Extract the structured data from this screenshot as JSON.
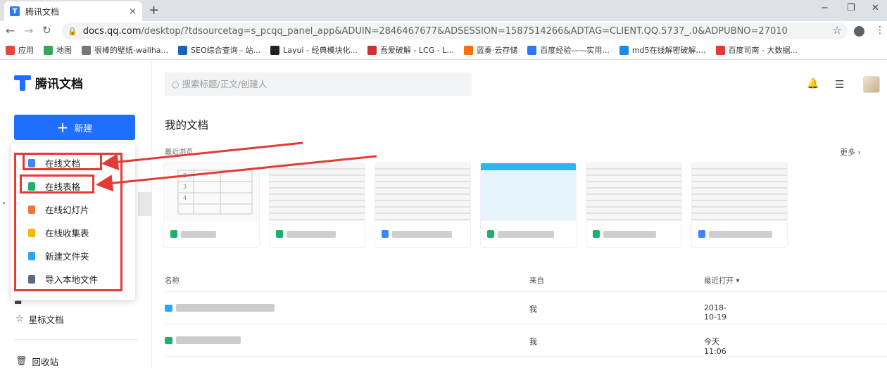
{
  "browser": {
    "tab_title": "腾讯文档",
    "tab_close": "×",
    "new_tab": "+",
    "url_host": "docs.qq.com",
    "url_rest": "/desktop/?tdsourcetag=s_pcqq_panel_app&ADUIN=2846467677&ADSESSION=1587514266&ADTAG=CLIENT.QQ.5737_.0&ADPUBNO=27010",
    "window_controls": [
      "−",
      "❐",
      "✕"
    ],
    "bookmarks": [
      {
        "label": "应用",
        "color": "#e8453c"
      },
      {
        "label": "地图",
        "color": "#34a853"
      },
      {
        "label": "很棒的壁纸-wallha...",
        "color": "#777777"
      },
      {
        "label": "SEO综合查询 - 站...",
        "color": "#1565c0"
      },
      {
        "label": "Layui - 经典模块化...",
        "color": "#222222"
      },
      {
        "label": "吾爱破解 - LCG - L...",
        "color": "#d32f2f"
      },
      {
        "label": "蓝奏·云存储",
        "color": "#ff6f00"
      },
      {
        "label": "百度经验——实用...",
        "color": "#2979ff"
      },
      {
        "label": "md5在线解密破解,...",
        "color": "#1e88e5"
      },
      {
        "label": "百度司南 - 大数据...",
        "color": "#e53935"
      }
    ]
  },
  "app": {
    "logo_text": "腾讯文档",
    "new_button": "新建",
    "new_menu": [
      {
        "label": "在线文档",
        "color": "#3a86ff"
      },
      {
        "label": "在线表格",
        "color": "#1db16e"
      },
      {
        "label": "在线幻灯片",
        "color": "#f4743b"
      },
      {
        "label": "在线收集表",
        "color": "#f5b800"
      },
      {
        "label": "新建文件夹",
        "color": "#2fa6f5"
      },
      {
        "label": "导入本地文件",
        "color": "#5f6b7a"
      }
    ],
    "sidebar_starred": "星标文档",
    "sidebar_trash": "回收站",
    "search_placeholder": "搜索标题/正文/创建人",
    "section_title": "我的文档",
    "recent_label": "最近浏览",
    "more_label": "更多 ›",
    "recent_cards": [
      {
        "type_color": "#1db16e"
      },
      {
        "type_color": "#1db16e"
      },
      {
        "type_color": "#3a86ff"
      },
      {
        "type_color": "#1db16e"
      },
      {
        "type_color": "#1db16e"
      },
      {
        "type_color": "#3a86ff"
      }
    ],
    "list_headers": {
      "name": "名称",
      "from": "来自",
      "last_opened": "最近打开 ▾"
    },
    "rows": [
      {
        "from": "我",
        "time": "2018-10-19",
        "type_color": "#2fa6f5"
      },
      {
        "from": "我",
        "time": "今天 11:06",
        "type_color": "#1db16e"
      }
    ],
    "sheet_row_nums": [
      "2",
      "3",
      "4"
    ]
  },
  "annotation_color": "#e53935"
}
